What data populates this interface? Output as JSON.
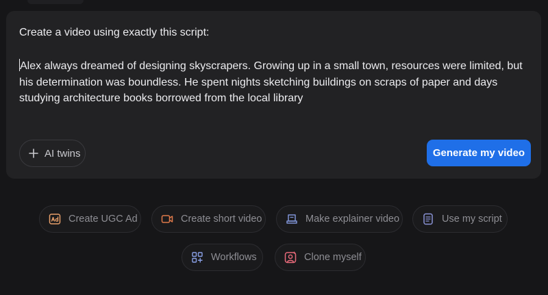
{
  "editor": {
    "prompt": "Create a video using exactly this script:",
    "script": "Alex always dreamed of designing skyscrapers. Growing up in a small town, resources were limited, but his determination was boundless. He spent nights sketching buildings on scraps of paper and days studying architecture books borrowed from the local library",
    "ai_twins_label": "AI twins",
    "generate_label": "Generate my video"
  },
  "suggestions": [
    {
      "label": "Create UGC Ad",
      "icon": "ad-icon",
      "color": "#e8a06a"
    },
    {
      "label": "Create short video",
      "icon": "video-camera-icon",
      "color": "#e07a4a"
    },
    {
      "label": "Make explainer video",
      "icon": "scroll-icon",
      "color": "#7f93d6"
    },
    {
      "label": "Use my script",
      "icon": "document-icon",
      "color": "#8a93d6"
    },
    {
      "label": "Workflows",
      "icon": "grid-plus-icon",
      "color": "#8aa0e6"
    },
    {
      "label": "Clone myself",
      "icon": "person-sparkle-icon",
      "color": "#e86a7a"
    }
  ]
}
